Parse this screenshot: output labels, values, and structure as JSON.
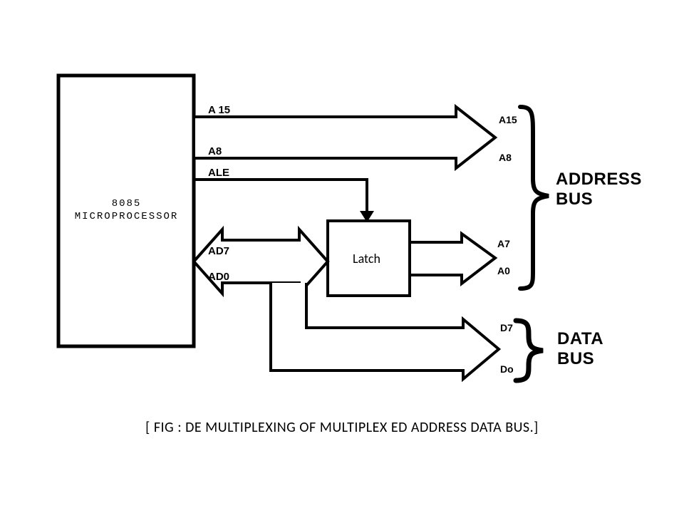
{
  "chip": {
    "name_line1": "8085",
    "name_line2": "MICROPROCESSOR",
    "pins": {
      "a15": "A 15",
      "a8": "A8",
      "ale": "ALE",
      "ad7": "AD7",
      "ad0": "AD0"
    }
  },
  "latch": {
    "label": "Latch"
  },
  "outputs": {
    "a15": "A15",
    "a8": "A8",
    "a7": "A7",
    "a0": "A0",
    "d7": "D7",
    "d0": "Do"
  },
  "bus_labels": {
    "address_l1": "ADDRESS",
    "address_l2": "BUS",
    "data_l1": "DATA",
    "data_l2": "BUS"
  },
  "caption": "[ FIG : DE MULTIPLEXING OF MULTIPLEX ED ADDRESS DATA BUS.]"
}
